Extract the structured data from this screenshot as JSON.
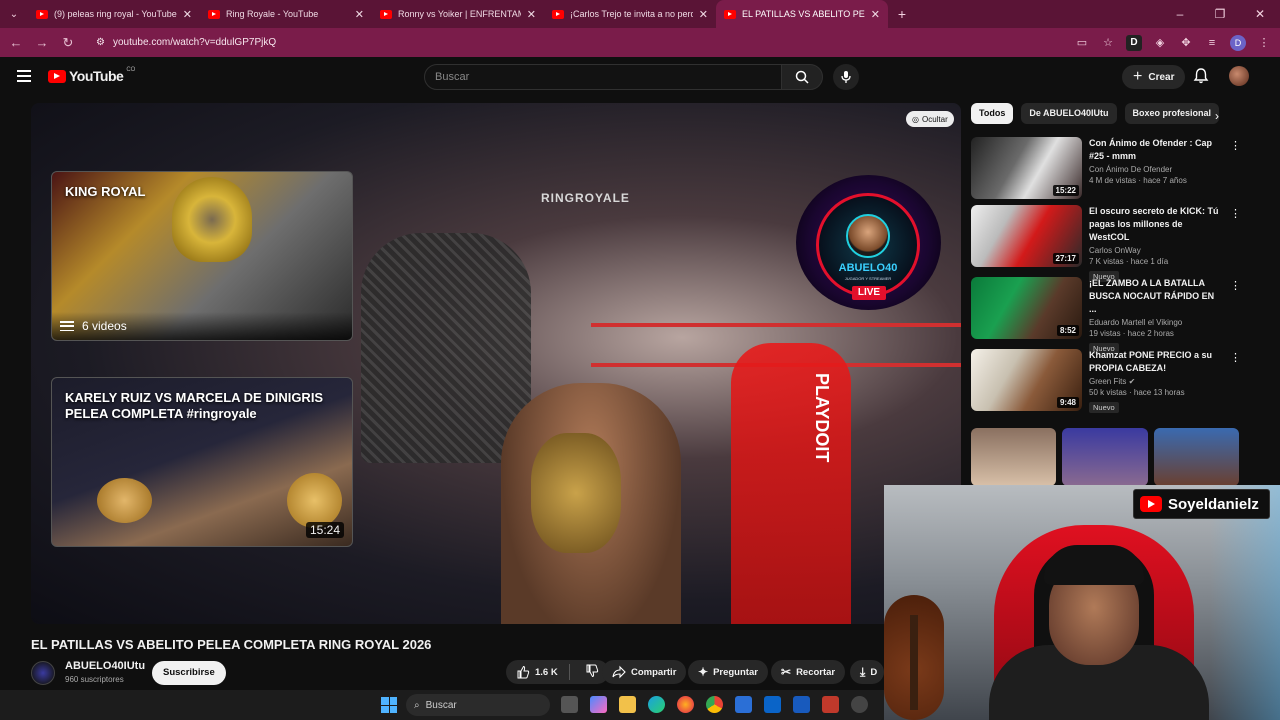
{
  "browser": {
    "tabs": [
      {
        "title": "(9) peleas ring royal - YouTube",
        "active": false
      },
      {
        "title": "Ring Royale - YouTube",
        "active": false
      },
      {
        "title": "Ronny vs Yoiker | ENFRENTAMI",
        "active": false
      },
      {
        "title": "¡Carlos Trejo te invita a no perd",
        "active": false
      },
      {
        "title": "EL PATILLAS VS ABELITO PE",
        "active": true
      }
    ],
    "url": "youtube.com/watch?v=ddulGP7PjkQ",
    "profile_initial": "D",
    "ext_letter": "D",
    "accent_color": "#7a1c4a"
  },
  "header": {
    "logo_text": "YouTube",
    "country": "CO",
    "search_placeholder": "Buscar",
    "create_label": "Crear"
  },
  "player": {
    "hide_label": "Ocultar",
    "watermark": "RINGROYALE",
    "sponsor": "PLAYDOIT",
    "stream_badge": {
      "name": "ABUELO40",
      "sub": "JUGADOR Y STREAMER",
      "live": "LIVE"
    },
    "end_cards": [
      {
        "title": "KING ROYAL",
        "meta": "6 videos"
      },
      {
        "title": "KARELY RUIZ VS MARCELA DE DINIGRIS PELEA COMPLETA #ringroyale",
        "duration": "15:24"
      }
    ]
  },
  "video": {
    "title": "EL PATILLAS VS ABELITO PELEA COMPLETA RING ROYAL 2026",
    "channel": "ABUELO40IUtu",
    "subscribers": "960 suscriptores",
    "subscribe_label": "Suscribirse",
    "likes": "1.6 K",
    "share_label": "Compartir",
    "ask_label": "Preguntar",
    "clip_label": "Recortar",
    "download_label": "D"
  },
  "sidebar": {
    "chips": [
      "Todos",
      "De ABUELO40IUtu",
      "Boxeo profesional"
    ],
    "recommendations": [
      {
        "title": "Con Ánimo de Ofender : Cap #25 - mmm",
        "channel": "Con Ánimo De Ofender",
        "meta": "4 M de vistas · hace 7 años",
        "duration": "15:22",
        "badge": ""
      },
      {
        "title": "El oscuro secreto de KICK: Tú pagas los millones de WestCOL",
        "channel": "Carlos OnWay",
        "meta": "7 K vistas · hace 1 día",
        "duration": "27:17",
        "badge": "Nuevo"
      },
      {
        "title": "¡EL ZAMBO A LA BATALLA BUSCA NOCAUT RÁPIDO EN ...",
        "channel": "Eduardo Martell el Vikingo",
        "meta": "19 vistas · hace 2 horas",
        "duration": "8:52",
        "badge": "Nuevo"
      },
      {
        "title": "Khamzat PONE PRECIO a su PROPIA CABEZA!",
        "channel": "Green Fits",
        "meta": "50 k vistas · hace 13 horas",
        "duration": "9:48",
        "badge": "Nuevo"
      }
    ]
  },
  "overlay": {
    "streamer_tag": "Soyeldanielz"
  },
  "taskbar": {
    "search_label": "Buscar"
  }
}
